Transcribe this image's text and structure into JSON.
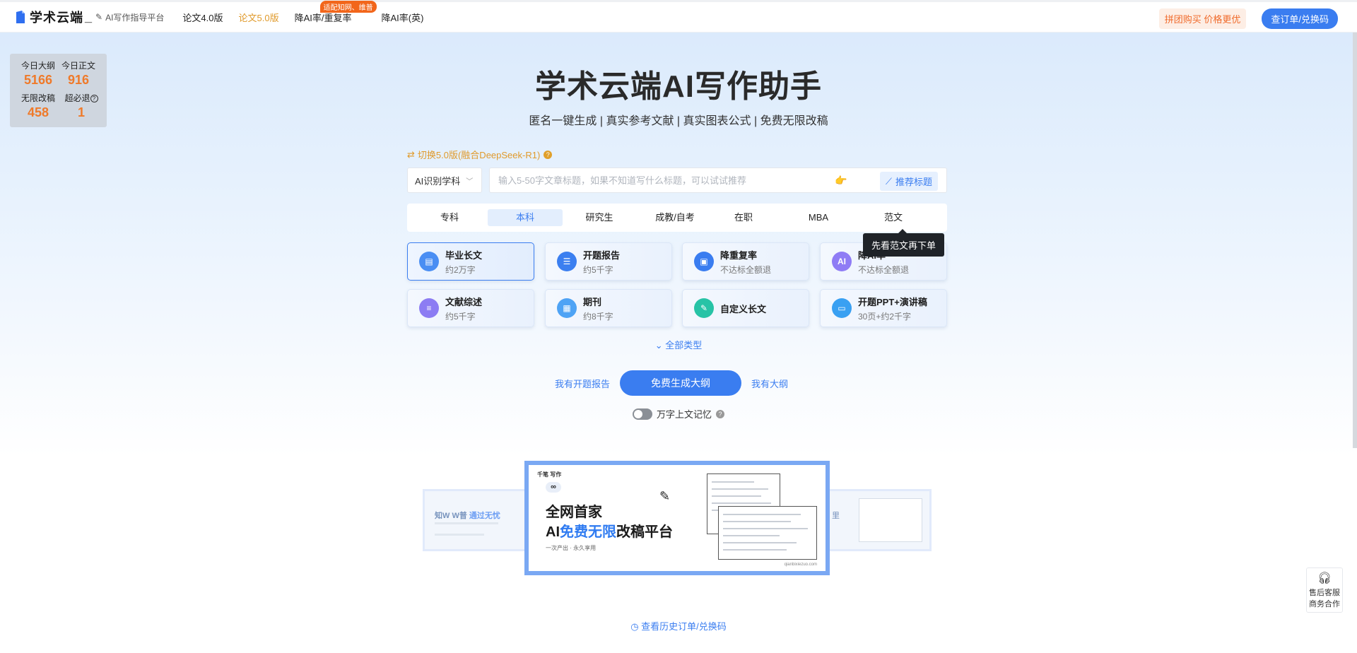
{
  "header": {
    "brand": "学术云端",
    "brand_suffix": "_",
    "subtitle": "AI写作指导平台",
    "nav": [
      {
        "label": "论文4.0版",
        "active": false
      },
      {
        "label": "论文5.0版",
        "active": true
      },
      {
        "label": "降AI率/重复率",
        "badge": "适配知网、维普"
      },
      {
        "label": "降AI率(英)"
      }
    ],
    "group_buy": "拼团购买 价格更优",
    "order_button": "查订单/兑换码"
  },
  "stats": [
    {
      "label": "今日大纲",
      "value": "5166"
    },
    {
      "label": "今日正文",
      "value": "916"
    },
    {
      "label": "无限改稿",
      "value": "458"
    },
    {
      "label": "超必退",
      "value": "1",
      "help_icon": "question-circle-icon"
    }
  ],
  "main": {
    "title": "学术云端AI写作助手",
    "subtitle": "匿名一键生成 | 真实参考文献 | 真实图表公式 | 免费无限改稿",
    "switch_label": "切换5.0版(融合DeepSeek-R1)",
    "subject_select": "AI识别学科",
    "search_placeholder": "输入5-50字文章标题，如果不知道写什么标题，可以试试推荐",
    "recommend_button": "推荐标题",
    "levels": [
      "专科",
      "本科",
      "研究生",
      "成教/自考",
      "在职",
      "MBA",
      "范文"
    ],
    "active_level": "本科",
    "tooltip": "先看范文再下单",
    "cards": [
      {
        "title": "毕业长文",
        "sub": "约2万字",
        "icon": "document-icon",
        "color": "#4a8ef3",
        "active": true
      },
      {
        "title": "开题报告",
        "sub": "约5千字",
        "icon": "report-icon",
        "color": "#3b7ff0"
      },
      {
        "title": "降重复率",
        "sub": "不达标全额退",
        "icon": "screen-icon",
        "color": "#3a7df0"
      },
      {
        "title": "降AI率",
        "sub": "不达标全额退",
        "icon": "ai-icon",
        "color": "#8f7cf5"
      },
      {
        "title": "文献综述",
        "sub": "约5千字",
        "icon": "list-doc-icon",
        "color": "#8c7cf3"
      },
      {
        "title": "期刊",
        "sub": "约8千字",
        "icon": "journal-icon",
        "color": "#4ea3f5"
      },
      {
        "title": "自定义长文",
        "sub": "",
        "icon": "pen-doc-icon",
        "color": "#27c3a6"
      },
      {
        "title": "开题PPT+演讲稿",
        "sub": "30页+约2千字",
        "icon": "ppt-icon",
        "color": "#39a0f2"
      }
    ],
    "all_types": "全部类型",
    "have_proposal": "我有开题报告",
    "generate_button": "免费生成大纲",
    "have_outline": "我有大纲",
    "memory_label": "万字上文记忆"
  },
  "banner": {
    "brand": "千笔 写作",
    "infinity": "∞",
    "line1": "全网首家",
    "line2_prefix": "AI",
    "line2_highlight": "免费无限",
    "line2_suffix": "改稿平台",
    "small": "一次产出 · 永久享用",
    "site": "qianbixiezuo.com",
    "left_title_a": "知W W普",
    "left_title_b": "通过无忧",
    "right_char": "里"
  },
  "history_link": "查看历史订单/兑换码",
  "service": {
    "line1": "售后客服",
    "line2": "商务合作"
  }
}
